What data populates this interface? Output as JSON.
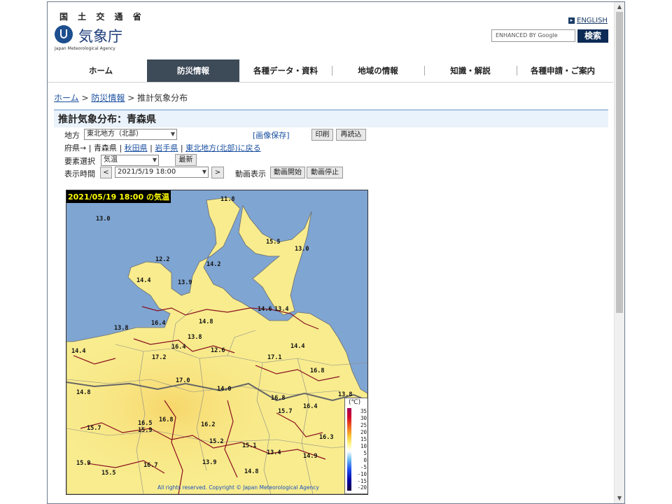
{
  "header": {
    "ministry": "国 土 交 通 省",
    "logo_title": "気象庁",
    "logo_subtitle": "Japan Meteorological Agency",
    "english_link": "ENGLISH",
    "search_placeholder": "ENHANCED BY Google",
    "search_button": "検索"
  },
  "nav": {
    "items": [
      "ホーム",
      "防災情報",
      "各種データ・資料",
      "地域の情報",
      "知識・解説",
      "各種申請・ご案内"
    ],
    "active": "防災情報"
  },
  "breadcrumb": {
    "home": "ホーム",
    "sep1": ">",
    "disaster": "防災情報",
    "sep2": ">",
    "current": "推計気象分布"
  },
  "page_title": "推計気象分布：青森県",
  "controls": {
    "region_label": "地方",
    "region_value": "東北地方（北部）",
    "save_image": "[画像保存]",
    "print_button": "印刷",
    "reload_button": "再読込",
    "pref_label": "府県→",
    "pref_current": "青森県",
    "pref_sep": "|",
    "pref_akita": "秋田県",
    "pref_iwate": "岩手県",
    "pref_back": "東北地方(北部)に戻る",
    "element_label": "要素選択",
    "element_value": "気温",
    "latest_button": "最新",
    "time_label": "表示時間",
    "prev_button": "<",
    "time_value": "2021/5/19 18:00",
    "next_button": ">",
    "anim_label": "動画表示",
    "anim_start": "動画開始",
    "anim_stop": "動画停止"
  },
  "map": {
    "title": "2021/05/19 18:00 の気温",
    "unit": "(℃)",
    "legend_values": [
      "35",
      "30",
      "25",
      "20",
      "15",
      "10",
      "5",
      "0",
      "-5",
      "-10",
      "-15",
      "-20"
    ],
    "copyright": "All rights reserved. Copyright © Japan Meteorological Agency",
    "temperature_labels": [
      "11.8",
      "13.0",
      "15.5",
      "13.0",
      "12.2",
      "14.2",
      "14.4",
      "13.9",
      "14.6",
      "13.4",
      "13.8",
      "16.4",
      "14.8",
      "16.4",
      "13.8",
      "12.6",
      "14.4",
      "14.4",
      "17.2",
      "17.1",
      "16.8",
      "17.0",
      "14.0",
      "14.8",
      "13.8",
      "16.8",
      "15.7",
      "16.4",
      "16.5",
      "15.9",
      "16.8",
      "15.7",
      "16.2",
      "16.3",
      "15.2",
      "15.1",
      "15.9",
      "13.4",
      "14.9",
      "16.7",
      "13.9",
      "15.5",
      "14.8"
    ]
  },
  "colors": {
    "nav_active": "#3d4a58",
    "link": "#1a50a0",
    "title_bg": "#eaf2fb",
    "sea": "#7fa5d2",
    "land": "#f8ec8e"
  }
}
